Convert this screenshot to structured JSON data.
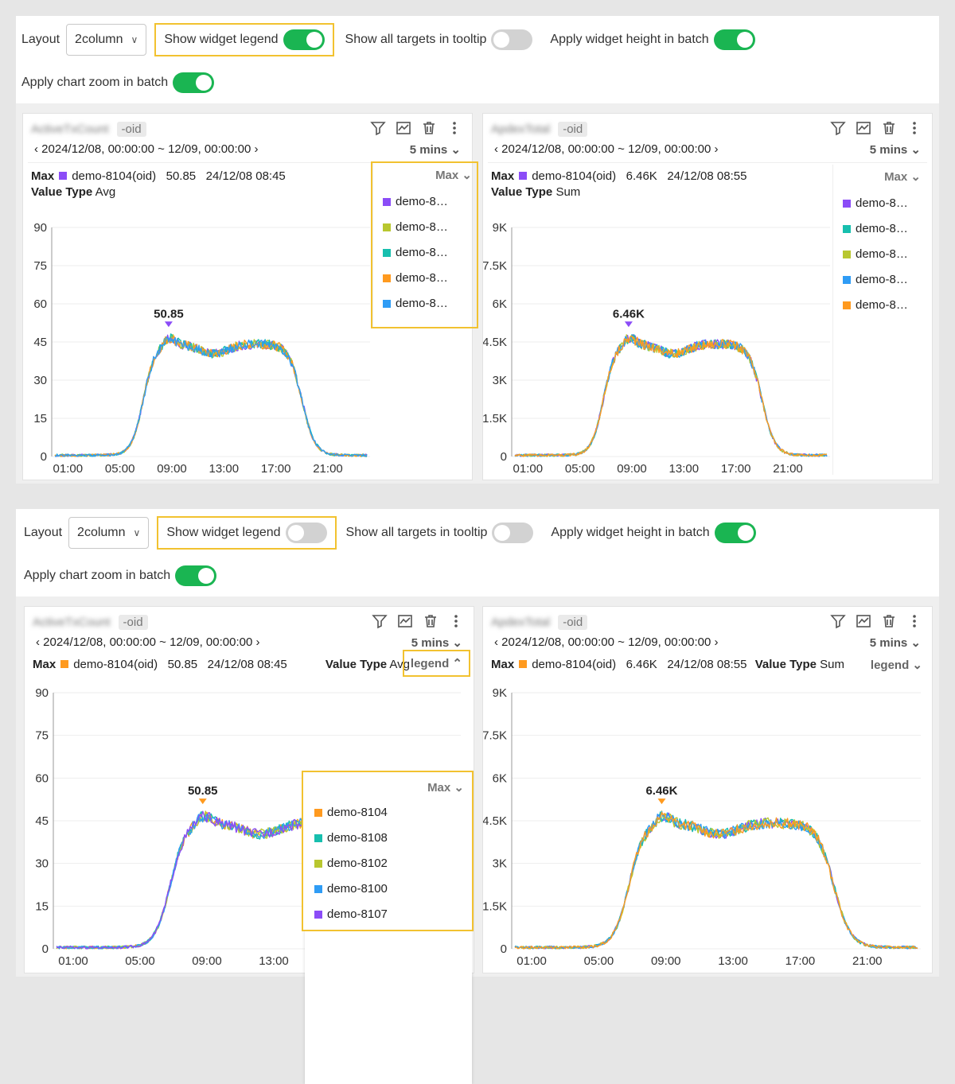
{
  "panels": [
    {
      "toolbar": {
        "layout_label": "Layout",
        "layout_value": "2column",
        "show_legend_label": "Show widget legend",
        "show_legend_on": true,
        "show_targets_label": "Show all targets in tooltip",
        "show_targets_on": false,
        "apply_height_label": "Apply widget height in batch",
        "apply_height_on": true,
        "apply_zoom_label": "Apply chart zoom in batch",
        "apply_zoom_on": true
      },
      "charts": [
        {
          "title": "ActiveTxCount",
          "suffix": "-oid",
          "date_range": "2024/12/08, 00:00:00 ~ 12/09, 00:00:00",
          "interval": "5 mins",
          "max_label": "Max",
          "max_target": "demo-8104(oid)",
          "max_value": "50.85",
          "max_time": "24/12/08 08:45",
          "max_color": "#8b4cf7",
          "value_type_label": "Value Type",
          "value_type": "Avg",
          "peak_label": "50.85",
          "legend_header": "Max",
          "legend": [
            {
              "label": "demo-8…",
              "color": "#8b4cf7"
            },
            {
              "label": "demo-8…",
              "color": "#b8c72f"
            },
            {
              "label": "demo-8…",
              "color": "#17bfae"
            },
            {
              "label": "demo-8…",
              "color": "#ff9a1f"
            },
            {
              "label": "demo-8…",
              "color": "#2f9cf5"
            }
          ],
          "yticks": [
            "90",
            "75",
            "60",
            "45",
            "30",
            "15",
            "0"
          ],
          "xticks": [
            "01:00",
            "05:00",
            "09:00",
            "13:00",
            "17:00",
            "21:00"
          ]
        },
        {
          "title": "ApdexTotal",
          "suffix": "-oid",
          "date_range": "2024/12/08, 00:00:00 ~ 12/09, 00:00:00",
          "interval": "5 mins",
          "max_label": "Max",
          "max_target": "demo-8104(oid)",
          "max_value": "6.46K",
          "max_time": "24/12/08 08:55",
          "max_color": "#8b4cf7",
          "value_type_label": "Value Type",
          "value_type": "Sum",
          "peak_label": "6.46K",
          "legend_header": "Max",
          "legend": [
            {
              "label": "demo-8…",
              "color": "#8b4cf7"
            },
            {
              "label": "demo-8…",
              "color": "#17bfae"
            },
            {
              "label": "demo-8…",
              "color": "#b8c72f"
            },
            {
              "label": "demo-8…",
              "color": "#2f9cf5"
            },
            {
              "label": "demo-8…",
              "color": "#ff9a1f"
            }
          ],
          "yticks": [
            "9K",
            "7.5K",
            "6K",
            "4.5K",
            "3K",
            "1.5K",
            "0"
          ],
          "xticks": [
            "01:00",
            "05:00",
            "09:00",
            "13:00",
            "17:00",
            "21:00"
          ]
        }
      ]
    },
    {
      "toolbar": {
        "layout_label": "Layout",
        "layout_value": "2column",
        "show_legend_label": "Show widget legend",
        "show_legend_on": false,
        "show_targets_label": "Show all targets in tooltip",
        "show_targets_on": false,
        "apply_height_label": "Apply widget height in batch",
        "apply_height_on": true,
        "apply_zoom_label": "Apply chart zoom in batch",
        "apply_zoom_on": true
      },
      "charts": [
        {
          "title": "ActiveTxCount",
          "suffix": "-oid",
          "date_range": "2024/12/08, 00:00:00 ~ 12/09, 00:00:00",
          "interval": "5 mins",
          "max_label": "Max",
          "max_target": "demo-8104(oid)",
          "max_value": "50.85",
          "max_time": "24/12/08 08:45",
          "max_color": "#ff9a1f",
          "value_type_label": "Value Type",
          "value_type": "Avg",
          "legend_toggle": "legend",
          "peak_label": "50.85",
          "legend_header": "Max",
          "legend": [
            {
              "label": "demo-8104",
              "color": "#ff9a1f"
            },
            {
              "label": "demo-8108",
              "color": "#17bfae"
            },
            {
              "label": "demo-8102",
              "color": "#b8c72f"
            },
            {
              "label": "demo-8100",
              "color": "#2f9cf5"
            },
            {
              "label": "demo-8107",
              "color": "#8b4cf7"
            }
          ],
          "yticks": [
            "90",
            "75",
            "60",
            "45",
            "30",
            "15",
            "0"
          ],
          "xticks": [
            "01:00",
            "05:00",
            "09:00",
            "13:00"
          ]
        },
        {
          "title": "ApdexTotal",
          "suffix": "-oid",
          "date_range": "2024/12/08, 00:00:00 ~ 12/09, 00:00:00",
          "interval": "5 mins",
          "max_label": "Max",
          "max_target": "demo-8104(oid)",
          "max_value": "6.46K",
          "max_time": "24/12/08 08:55",
          "max_color": "#ff9a1f",
          "value_type_label": "Value Type",
          "value_type": "Sum",
          "legend_toggle": "legend",
          "peak_label": "6.46K",
          "yticks": [
            "9K",
            "7.5K",
            "6K",
            "4.5K",
            "3K",
            "1.5K",
            "0"
          ],
          "xticks": [
            "01:00",
            "05:00",
            "09:00",
            "13:00",
            "17:00",
            "21:00"
          ]
        }
      ]
    }
  ]
}
